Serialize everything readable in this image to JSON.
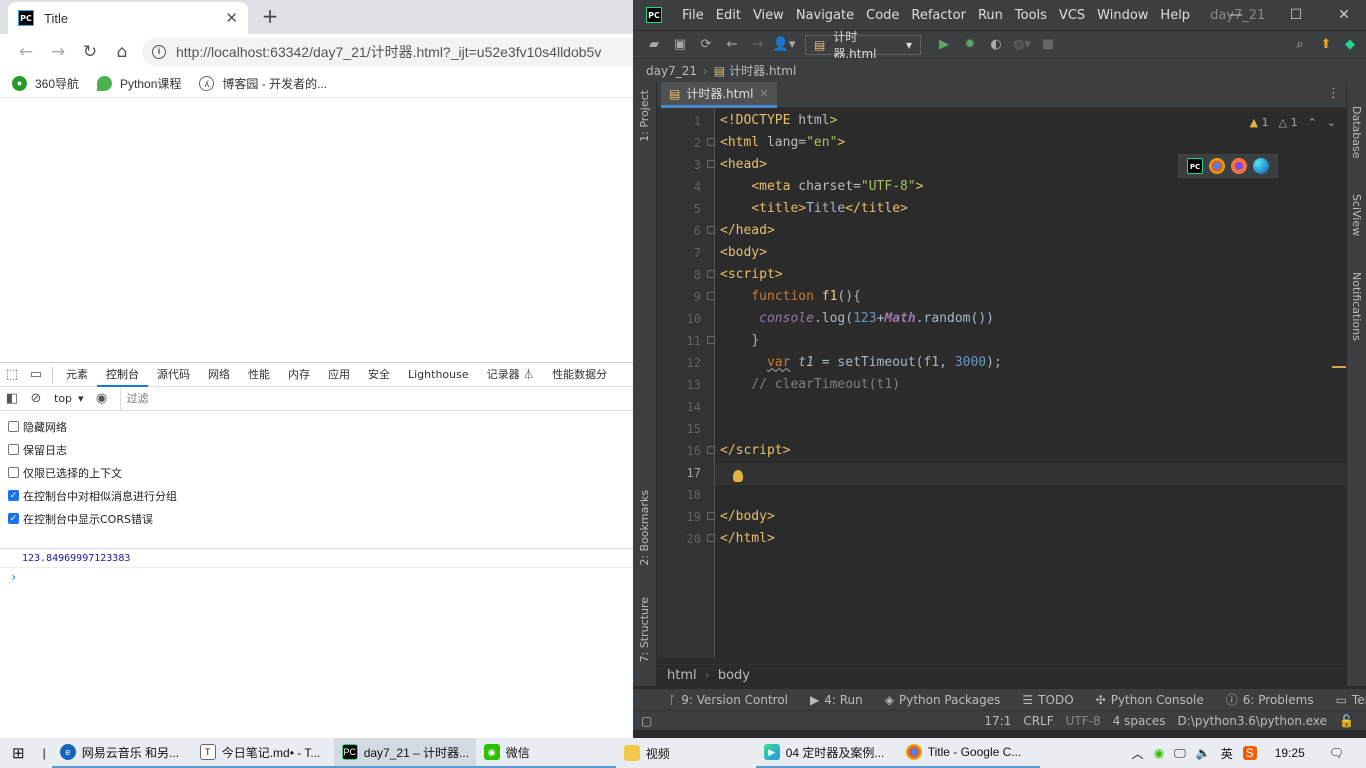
{
  "browser": {
    "tab_title": "Title",
    "favicon_text": "PC",
    "url": "http://localhost:63342/day7_21/计时器.html?_ijt=u52e3fv10s4lldob5v",
    "bookmarks": [
      {
        "label": "360导航"
      },
      {
        "label": "Python课程"
      },
      {
        "label": "博客园 - 开发者的..."
      }
    ]
  },
  "devtools": {
    "tabs": [
      "元素",
      "控制台",
      "源代码",
      "网络",
      "性能",
      "内存",
      "应用",
      "安全",
      "Lighthouse",
      "记录器 ⏃",
      "性能数据分"
    ],
    "active_tab": "控制台",
    "context": "top",
    "filter_placeholder": "过滤",
    "options": [
      {
        "label": "隐藏网络",
        "checked": false
      },
      {
        "label": "保留日志",
        "checked": false
      },
      {
        "label": "仅限已选择的上下文",
        "checked": false
      },
      {
        "label": "在控制台中对相似消息进行分组",
        "checked": true
      },
      {
        "label": "在控制台中显示CORS错误",
        "checked": true
      }
    ],
    "log_output": "123.84969997123383",
    "prompt": "›"
  },
  "ide": {
    "logo_text": "PC",
    "menu": [
      "File",
      "Edit",
      "View",
      "Navigate",
      "Code",
      "Refactor",
      "Run",
      "Tools",
      "VCS",
      "Window",
      "Help"
    ],
    "project": "day7_21",
    "run_config": "计时器.html",
    "breadcrumb_project": "day7_21",
    "breadcrumb_file": "计时器.html",
    "file_tab": "计时器.html",
    "left_tools": [
      "1: Project",
      "2: Bookmarks",
      "7: Structure"
    ],
    "right_tools": [
      "Database",
      "SciView",
      "Notifications"
    ],
    "warnings": {
      "warn": "1",
      "weak": "1"
    },
    "line_numbers": [
      "1",
      "2",
      "3",
      "4",
      "5",
      "6",
      "7",
      "8",
      "9",
      "10",
      "11",
      "12",
      "13",
      "14",
      "15",
      "16",
      "17",
      "18",
      "19",
      "20"
    ],
    "editor_breadcrumb": [
      "html",
      "body"
    ],
    "tool_windows": [
      "9: Version Control",
      "4: Run",
      "Python Packages",
      "TODO",
      "Python Console",
      "6: Problems",
      "Terminal"
    ],
    "status": {
      "position": "17:1",
      "line_sep": "CRLF",
      "encoding": "UTF-8",
      "indent": "4 spaces",
      "interpreter": "D:\\python3.6\\python.exe"
    }
  },
  "taskbar": {
    "items": [
      {
        "label": "网易云音乐 和另..."
      },
      {
        "label": "今日笔记.md• - T..."
      },
      {
        "label": "day7_21 – 计时器..."
      },
      {
        "label": "微信"
      },
      {
        "label": "视频"
      },
      {
        "label": "04 定时器及案例..."
      },
      {
        "label": "Title - Google C..."
      }
    ],
    "time": "19:25"
  },
  "colors": {
    "ide_bg": "#2b2b2b",
    "ide_panel": "#3c3f41",
    "accent_blue": "#1a73e8",
    "run_green": "#59a869",
    "tag_yellow": "#e8bf6a"
  }
}
